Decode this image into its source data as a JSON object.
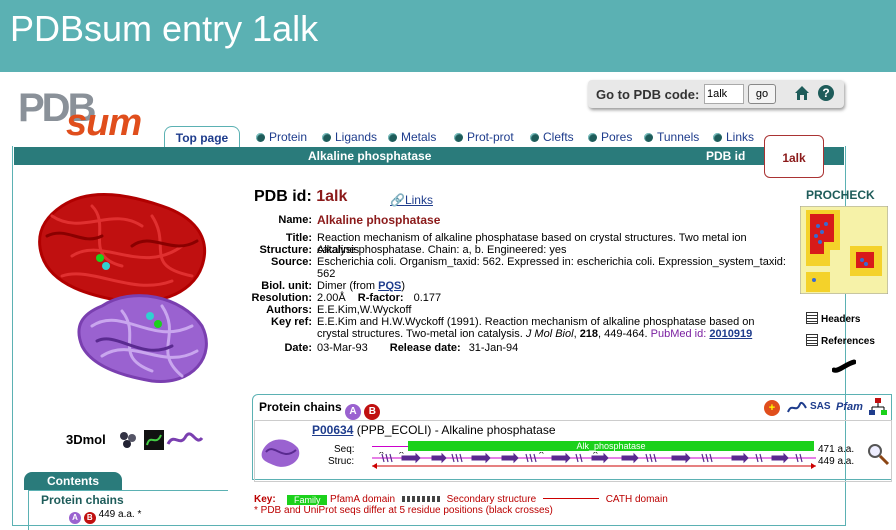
{
  "banner": {
    "title": "PDBsum entry 1alk"
  },
  "logo": {
    "part1": "PDB",
    "part2": "sum"
  },
  "goto": {
    "label": "Go to PDB code:",
    "value": "1alk",
    "button": "go"
  },
  "nav": {
    "top_tab": "Top page",
    "tabs": [
      "Protein",
      "Ligands",
      "Metals",
      "Prot-prot",
      "Clefts",
      "Pores",
      "Tunnels",
      "Links"
    ]
  },
  "titlebar": {
    "title": "Alkaline phosphatase",
    "pdb_id_label": "PDB id",
    "pdb_id_value": "1alk"
  },
  "entry": {
    "pdb_id_label": "PDB id:",
    "pdb_id": "1alk",
    "links": "Links",
    "name_label": "Name:",
    "name": "Alkaline phosphatase",
    "title_label": "Title:",
    "title": "Reaction mechanism of alkaline phosphatase based on crystal structures. Two metal ion catalysis",
    "structure_label": "Structure:",
    "structure": "Alkaline phosphatase. Chain: a, b. Engineered: yes",
    "source_label": "Source:",
    "source": "Escherichia coli. Organism_taxid: 562. Expressed in: escherichia coli. Expression_system_taxid: 562",
    "biol_unit_label": "Biol. unit:",
    "biol_unit": "Dimer (from ",
    "biol_unit_link": "PQS",
    "biol_unit_end": ")",
    "resolution_label": "Resolution:",
    "resolution": "2.00Å",
    "rfactor_label": "R-factor:",
    "rfactor": "0.177",
    "authors_label": "Authors:",
    "authors": "E.E.Kim,W.Wyckoff",
    "keyref_label": "Key ref:",
    "keyref": "E.E.Kim and H.W.Wyckoff (1991). Reaction mechanism of alkaline phosphatase based on crystal structures. Two-metal ion catalysis.",
    "journal": "J Mol Biol",
    "volume": "218",
    "pages": ", 449-464.",
    "pubmed_label": "PubMed id:",
    "pubmed_id": "2010919",
    "date_label": "Date:",
    "date": "03-Mar-93",
    "release_label": "Release date:",
    "release": "31-Jan-94"
  },
  "procheck": {
    "title": "PROCHECK",
    "headers": "Headers",
    "references": "References"
  },
  "viewers": {
    "label": "3Dmol"
  },
  "chains": {
    "header": "Protein chains",
    "chain_a": "A",
    "chain_b": "B",
    "accession": "P00634",
    "uniprot_name": "(PPB_ECOLI) -  Alkaline phosphatase",
    "seq_label": "Seq:",
    "struc_label": "Struc:",
    "pfam_domain": "Alk_phosphatase",
    "seq_len": "471 a.a.",
    "struc_len": "449 a.a."
  },
  "key": {
    "label": "Key:",
    "family": "Family",
    "pfam": "PfamA domain",
    "secondary": "Secondary structure",
    "cath": "CATH domain",
    "note": "* PDB and UniProt seqs differ at 5 residue positions (black crosses)"
  },
  "contents": {
    "title": "Contents",
    "protein_chains": "Protein chains",
    "sub": "449 a.a. *"
  },
  "colors": {
    "banner": "#5bb1b3",
    "titlebar": "#2a7b7b",
    "accent_red": "#8b1a1a",
    "link_blue": "#1e3c8c",
    "pfam_green": "#1bd11b"
  }
}
